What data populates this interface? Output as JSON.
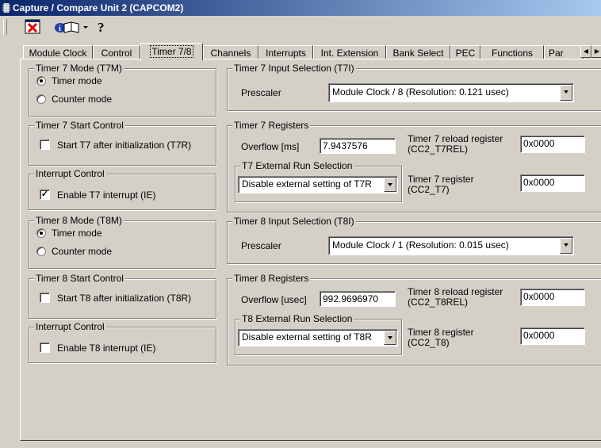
{
  "window": {
    "title": "Capture / Compare Unit 2 (CAPCOM2)"
  },
  "toolbar": {
    "icons": [
      "close-red-x-icon",
      "info-book-icon",
      "dropdown-arrow-icon",
      "help-question-icon"
    ],
    "help_glyph": "?"
  },
  "tabs": [
    {
      "label": "Module Clock"
    },
    {
      "label": "Control"
    },
    {
      "label": "Timer 7/8",
      "active": true
    },
    {
      "label": "Channels"
    },
    {
      "label": "Interrupts"
    },
    {
      "label": "Int. Extension"
    },
    {
      "label": "Bank Select"
    },
    {
      "label": "PEC"
    },
    {
      "label": "Functions"
    },
    {
      "label": "Par"
    }
  ],
  "t7_mode": {
    "title": "Timer 7 Mode (T7M)",
    "timer_mode": "Timer mode",
    "counter_mode": "Counter mode",
    "selected": "timer"
  },
  "t7_start": {
    "title": "Timer 7 Start Control",
    "label": "Start T7 after initialization (T7R)",
    "checked": false
  },
  "t7_int": {
    "title": "Interrupt Control",
    "label": "Enable T7 interrupt (IE)",
    "checked": true
  },
  "t8_mode": {
    "title": "Timer 8 Mode (T8M)",
    "timer_mode": "Timer mode",
    "counter_mode": "Counter mode",
    "selected": "timer"
  },
  "t8_start": {
    "title": "Timer 8 Start Control",
    "label": "Start T8 after initialization (T8R)",
    "checked": false
  },
  "t8_int": {
    "title": "Interrupt Control",
    "label": "Enable T8 interrupt (IE)",
    "checked": false
  },
  "t7_input": {
    "title": "Timer 7 Input Selection (T7I)",
    "prescaler_label": "Prescaler",
    "prescaler_value": "Module Clock / 8 (Resolution: 0.121 usec)"
  },
  "t7_regs": {
    "title": "Timer 7 Registers",
    "overflow_label": "Overflow [ms]",
    "overflow_value": "7.9437576",
    "reload_label_1": "Timer 7 reload register",
    "reload_label_2": "(CC2_T7REL)",
    "reload_value": "0x0000",
    "ext_title": "T7 External Run Selection",
    "ext_value": "Disable external setting of T7R",
    "reg_label_1": "Timer 7 register",
    "reg_label_2": "(CC2_T7)",
    "reg_value": "0x0000"
  },
  "t8_input": {
    "title": "Timer 8 Input Selection (T8I)",
    "prescaler_label": "Prescaler",
    "prescaler_value": "Module Clock / 1 (Resolution: 0.015 usec)"
  },
  "t8_regs": {
    "title": "Timer 8 Registers",
    "overflow_label": "Overflow [usec]",
    "overflow_value": "992.9696970",
    "reload_label_1": "Timer 8 reload register",
    "reload_label_2": "(CC2_T8REL)",
    "reload_value": "0x0000",
    "ext_title": "T8 External Run Selection",
    "ext_value": "Disable external setting of T8R",
    "reg_label_1": "Timer 8 register",
    "reg_label_2": "(CC2_T8)",
    "reg_value": "0x0000"
  },
  "colors": {
    "face": "#d4d0c8",
    "title_start": "#0a246a",
    "title_end": "#a6caf0"
  }
}
